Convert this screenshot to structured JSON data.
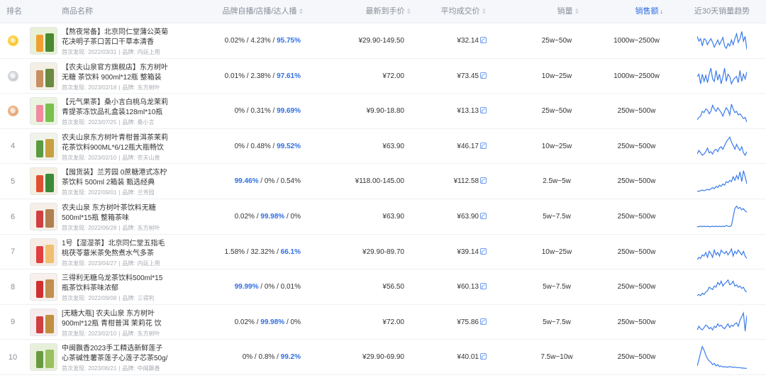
{
  "columns": {
    "rank": "排名",
    "product": "商品名称",
    "channel": "品牌自播/店播/达人播",
    "price": "最新到手价",
    "avg_price": "平均成交价",
    "sales": "销量",
    "revenue": "销售额",
    "trend": "近30天销量趋势"
  },
  "sort_asc_desc_icon": "⇕",
  "sort_active_icon": "↓",
  "accent_color": "#2f6fe4",
  "meta_labels": {
    "found": "首次发现:",
    "brand": "品牌:"
  },
  "rows": [
    {
      "rank": "1",
      "medal": "gold",
      "name": "【熬夜常备】北京同仁堂蒲公英菊花决明子茶口苦口干草本清香150g/袋",
      "found": "2022/03/31",
      "brand": "内廷上用",
      "ch": [
        "0.02%",
        "4.23%",
        "95.75%"
      ],
      "hl": 2,
      "price": "¥29.90-149.50",
      "avg": "¥32.14",
      "sales": "25w~50w",
      "revenue": "1000w~2500w",
      "thumb": [
        "#e8f0d8",
        "#f0a030",
        "#4a8a30"
      ],
      "spark": [
        0.7,
        0.5,
        0.6,
        0.3,
        0.6,
        0.55,
        0.35,
        0.5,
        0.6,
        0.45,
        0.25,
        0.4,
        0.55,
        0.35,
        0.5,
        0.65,
        0.3,
        0.2,
        0.4,
        0.3,
        0.55,
        0.35,
        0.6,
        0.8,
        0.45,
        0.6,
        0.9,
        0.5,
        0.7,
        0.15
      ]
    },
    {
      "rank": "2",
      "medal": "silver",
      "name": "【农夫山泉官方旗舰店】东方树叶 无糖 茶饮料 900ml*12瓶 整箱装",
      "found": "2023/02/18",
      "brand": "东方树叶",
      "ch": [
        "0.01%",
        "2.38%",
        "97.61%"
      ],
      "hl": 2,
      "price": "¥72.00",
      "avg": "¥73.45",
      "sales": "10w~25w",
      "revenue": "1000w~2500w",
      "thumb": [
        "#f4efe4",
        "#c89060",
        "#6a8a40"
      ],
      "spark": [
        0.5,
        0.6,
        0.2,
        0.6,
        0.3,
        0.55,
        0.25,
        0.6,
        0.85,
        0.4,
        0.3,
        0.75,
        0.35,
        0.6,
        0.2,
        0.5,
        0.85,
        0.3,
        0.6,
        0.5,
        0.2,
        0.35,
        0.45,
        0.5,
        0.25,
        0.75,
        0.3,
        0.6,
        0.4,
        0.7
      ]
    },
    {
      "rank": "3",
      "medal": "bronze",
      "name": "【元气果茶】桑小言白桃乌龙茉莉青提茶冻饮品礼盒装128ml*10瓶",
      "found": "2023/07/25",
      "brand": "桑小言",
      "ch": [
        "0%",
        "0.31%",
        "99.69%"
      ],
      "hl": 2,
      "price": "¥9.90-18.80",
      "avg": "¥13.13",
      "sales": "25w~50w",
      "revenue": "250w~500w",
      "thumb": [
        "#eaf4e0",
        "#f08aa0",
        "#7ac050"
      ],
      "spark": [
        0.15,
        0.25,
        0.3,
        0.5,
        0.45,
        0.6,
        0.55,
        0.4,
        0.5,
        0.75,
        0.6,
        0.5,
        0.65,
        0.55,
        0.45,
        0.3,
        0.5,
        0.65,
        0.55,
        0.35,
        0.8,
        0.6,
        0.45,
        0.5,
        0.35,
        0.4,
        0.3,
        0.2,
        0.25,
        0.05
      ]
    },
    {
      "rank": "4",
      "medal": "",
      "name": "农夫山泉东方树叶青柑普洱茶茉莉花茶饮料900ML*6/12瓶大瓶畅饮装",
      "found": "2023/02/10",
      "brand": "农夫山泉",
      "ch": [
        "0%",
        "0.48%",
        "99.52%"
      ],
      "hl": 2,
      "price": "¥63.90",
      "avg": "¥46.17",
      "sales": "10w~25w",
      "revenue": "250w~500w",
      "thumb": [
        "#f0f3ea",
        "#5a9a40",
        "#c8a040"
      ],
      "spark": [
        0.2,
        0.35,
        0.25,
        0.15,
        0.2,
        0.3,
        0.45,
        0.25,
        0.3,
        0.2,
        0.35,
        0.4,
        0.3,
        0.45,
        0.5,
        0.4,
        0.55,
        0.7,
        0.8,
        0.9,
        0.7,
        0.55,
        0.4,
        0.6,
        0.45,
        0.35,
        0.5,
        0.25,
        0.15,
        0.3
      ]
    },
    {
      "rank": "5",
      "medal": "",
      "name": "【囤货装】兰芳园 0蔗糖港式冻柠茶饮料 500ml 2箱装 甄选经典",
      "found": "2022/09/01",
      "brand": "兰芳园",
      "ch": [
        "99.46%",
        "0%",
        "0.54%"
      ],
      "hl": 0,
      "price": "¥118.00-145.00",
      "avg": "¥112.58",
      "sales": "2.5w~5w",
      "revenue": "250w~500w",
      "thumb": [
        "#f4efe0",
        "#e05030",
        "#3a8a3a"
      ],
      "spark": [
        0.1,
        0.1,
        0.12,
        0.15,
        0.12,
        0.15,
        0.18,
        0.15,
        0.2,
        0.25,
        0.2,
        0.3,
        0.25,
        0.35,
        0.3,
        0.4,
        0.35,
        0.5,
        0.45,
        0.55,
        0.5,
        0.7,
        0.55,
        0.75,
        0.6,
        0.9,
        0.5,
        0.95,
        0.7,
        0.4
      ]
    },
    {
      "rank": "6",
      "medal": "",
      "name": "农夫山泉 东方树叶茶饮料无糖500ml*15瓶 整箱茶味",
      "found": "2022/06/28",
      "brand": "东方树叶",
      "ch": [
        "0.02%",
        "99.98%",
        "0%"
      ],
      "hl": 1,
      "price": "¥63.90",
      "avg": "¥63.90",
      "sales": "5w~7.5w",
      "revenue": "250w~500w",
      "thumb": [
        "#f6efe8",
        "#d04040",
        "#b08050"
      ],
      "spark": [
        0.1,
        0.1,
        0.12,
        0.1,
        0.12,
        0.1,
        0.12,
        0.1,
        0.1,
        0.12,
        0.1,
        0.12,
        0.1,
        0.12,
        0.1,
        0.12,
        0.1,
        0.15,
        0.12,
        0.1,
        0.15,
        0.5,
        0.85,
        0.95,
        0.85,
        0.9,
        0.8,
        0.85,
        0.75,
        0.7
      ]
    },
    {
      "rank": "7",
      "medal": "",
      "name": "1号【湿湿茶】北京同仁堂五指毛桃茯苓薏米茶免熬煮水气多茶155g/盒",
      "found": "2023/04/27",
      "brand": "内廷上用",
      "ch": [
        "1.58%",
        "32.32%",
        "66.1%"
      ],
      "hl": 2,
      "price": "¥29.90-89.70",
      "avg": "¥39.14",
      "sales": "10w~25w",
      "revenue": "250w~500w",
      "thumb": [
        "#f6ece4",
        "#e04040",
        "#f0c070"
      ],
      "spark": [
        0.2,
        0.3,
        0.25,
        0.4,
        0.35,
        0.5,
        0.3,
        0.55,
        0.45,
        0.3,
        0.6,
        0.4,
        0.5,
        0.35,
        0.6,
        0.5,
        0.45,
        0.55,
        0.4,
        0.5,
        0.65,
        0.35,
        0.55,
        0.45,
        0.6,
        0.5,
        0.4,
        0.55,
        0.35,
        0.25
      ]
    },
    {
      "rank": "8",
      "medal": "",
      "name": "三得利无糖乌龙茶饮料500ml*15瓶茶饮料茶味浓郁",
      "found": "2022/09/08",
      "brand": "三得利",
      "ch": [
        "99.99%",
        "0%",
        "0.01%"
      ],
      "hl": 0,
      "price": "¥56.50",
      "avg": "¥60.13",
      "sales": "5w~7.5w",
      "revenue": "250w~500w",
      "thumb": [
        "#f8f0ec",
        "#d03030",
        "#c09050"
      ],
      "spark": [
        0.15,
        0.2,
        0.15,
        0.25,
        0.2,
        0.3,
        0.35,
        0.5,
        0.45,
        0.4,
        0.55,
        0.5,
        0.7,
        0.6,
        0.75,
        0.55,
        0.65,
        0.7,
        0.8,
        0.6,
        0.65,
        0.75,
        0.55,
        0.6,
        0.5,
        0.55,
        0.45,
        0.5,
        0.35,
        0.3
      ]
    },
    {
      "rank": "9",
      "medal": "",
      "name": "[无糖大瓶] 农夫山泉 东方树叶900ml*12瓶 青柑普洱 茉莉花 饮料",
      "found": "2023/02/10",
      "brand": "东方树叶",
      "ch": [
        "0.02%",
        "99.98%",
        "0%"
      ],
      "hl": 1,
      "price": "¥72.00",
      "avg": "¥75.86",
      "sales": "5w~7.5w",
      "revenue": "250w~500w",
      "thumb": [
        "#f6ecee",
        "#d04040",
        "#c09040"
      ],
      "spark": [
        0.2,
        0.35,
        0.25,
        0.2,
        0.3,
        0.4,
        0.35,
        0.25,
        0.3,
        0.2,
        0.35,
        0.3,
        0.45,
        0.35,
        0.4,
        0.3,
        0.25,
        0.35,
        0.45,
        0.3,
        0.4,
        0.35,
        0.45,
        0.5,
        0.35,
        0.6,
        0.75,
        0.9,
        0.15,
        0.8
      ]
    },
    {
      "rank": "10",
      "medal": "",
      "name": "中闽飘香2023手工精选新鲜莲子心茶碱性薯茶莲子心莲子芯茶50g/罐",
      "found": "2023/06/21",
      "brand": "中闽飘香",
      "ch": [
        "0%",
        "0.8%",
        "99.2%"
      ],
      "hl": 2,
      "price": "¥29.90-69.90",
      "avg": "¥40.01",
      "sales": "7.5w~10w",
      "revenue": "250w~500w",
      "thumb": [
        "#e8f0dc",
        "#6a9a40",
        "#9ac060"
      ],
      "spark": [
        0.15,
        0.4,
        0.7,
        0.95,
        0.8,
        0.6,
        0.45,
        0.35,
        0.3,
        0.2,
        0.25,
        0.15,
        0.2,
        0.12,
        0.15,
        0.1,
        0.12,
        0.1,
        0.1,
        0.12,
        0.1,
        0.08,
        0.1,
        0.08,
        0.08,
        0.08,
        0.06,
        0.06,
        0.05,
        0.05
      ]
    }
  ]
}
